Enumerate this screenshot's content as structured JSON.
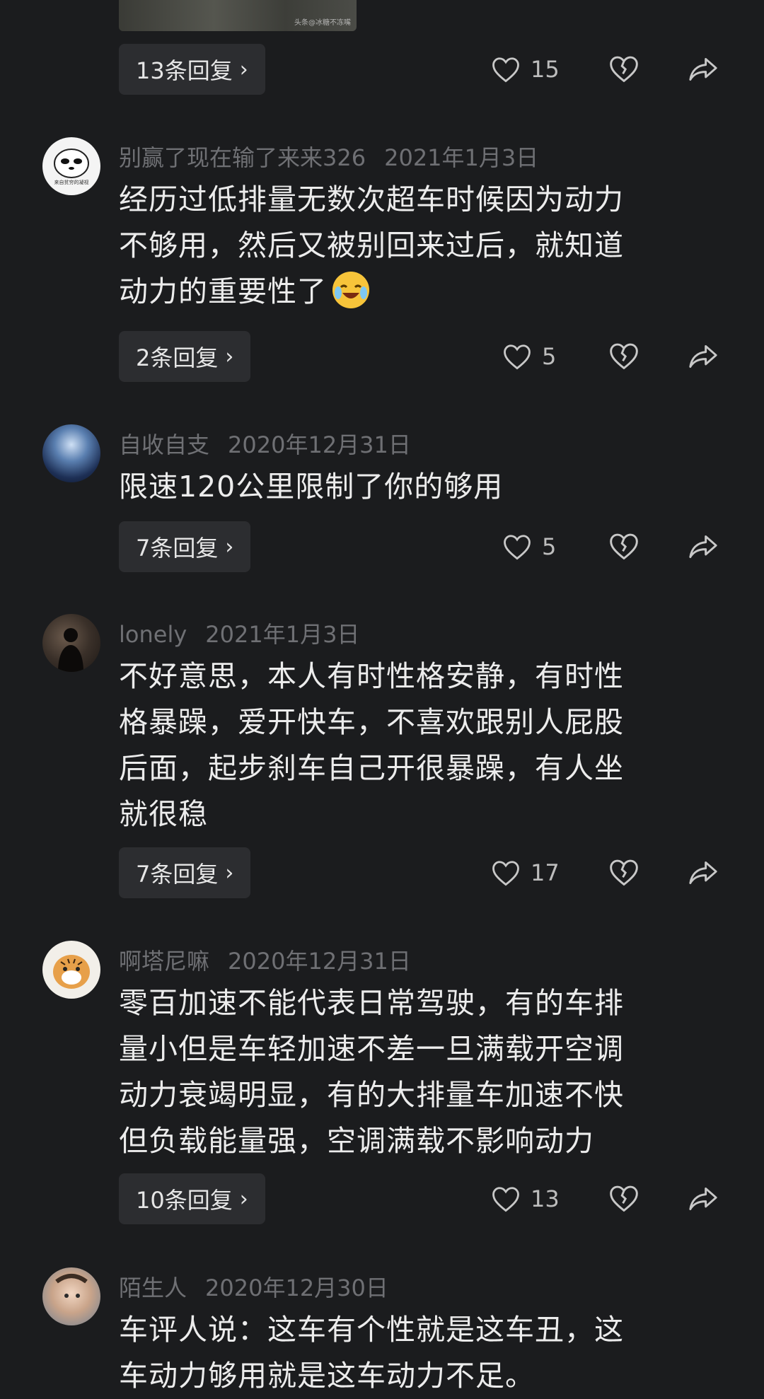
{
  "top_image": {
    "watermark": "头条@冰糖不冻嘴"
  },
  "colors": {
    "background": "#1b1c1e",
    "reply_button": "#2c2d30",
    "meta_text": "#6f7074",
    "body_text": "#ececec"
  },
  "first_actions": {
    "replies_label": "13条回复",
    "likes": "15"
  },
  "comments": [
    {
      "author": "别赢了现在输了来来326",
      "date": "2021年1月3日",
      "avatar_text": "来自贫穷的凝视",
      "text_lines": [
        "经历过低排量无数次超车时候因为动力",
        "不够用，然后又被别回来过后，就知道",
        "动力的重要性了"
      ],
      "emoji": "laughing-crying-emoji",
      "replies_label": "2条回复",
      "likes": "5"
    },
    {
      "author": "自收自支",
      "date": "2020年12月31日",
      "text_lines": [
        "限速120公里限制了你的够用"
      ],
      "replies_label": "7条回复",
      "likes": "5"
    },
    {
      "author": "lonely",
      "date": "2021年1月3日",
      "text_lines": [
        "不好意思，本人有时性格安静，有时性",
        "格暴躁，爱开快车，不喜欢跟别人屁股",
        "后面，起步刹车自己开很暴躁，有人坐",
        "就很稳"
      ],
      "replies_label": "7条回复",
      "likes": "17"
    },
    {
      "author": "啊塔尼嘛",
      "date": "2020年12月31日",
      "text_lines": [
        "零百加速不能代表日常驾驶，有的车排",
        "量小但是车轻加速不差一旦满载开空调",
        "动力衰竭明显，有的大排量车加速不快",
        "但负载能量强，空调满载不影响动力"
      ],
      "replies_label": "10条回复",
      "likes": "13"
    },
    {
      "author": "陌生人",
      "date": "2020年12月30日",
      "text_lines": [
        "车评人说：这车有个性就是这车丑，这",
        "车动力够用就是这车动力不足。"
      ]
    }
  ]
}
